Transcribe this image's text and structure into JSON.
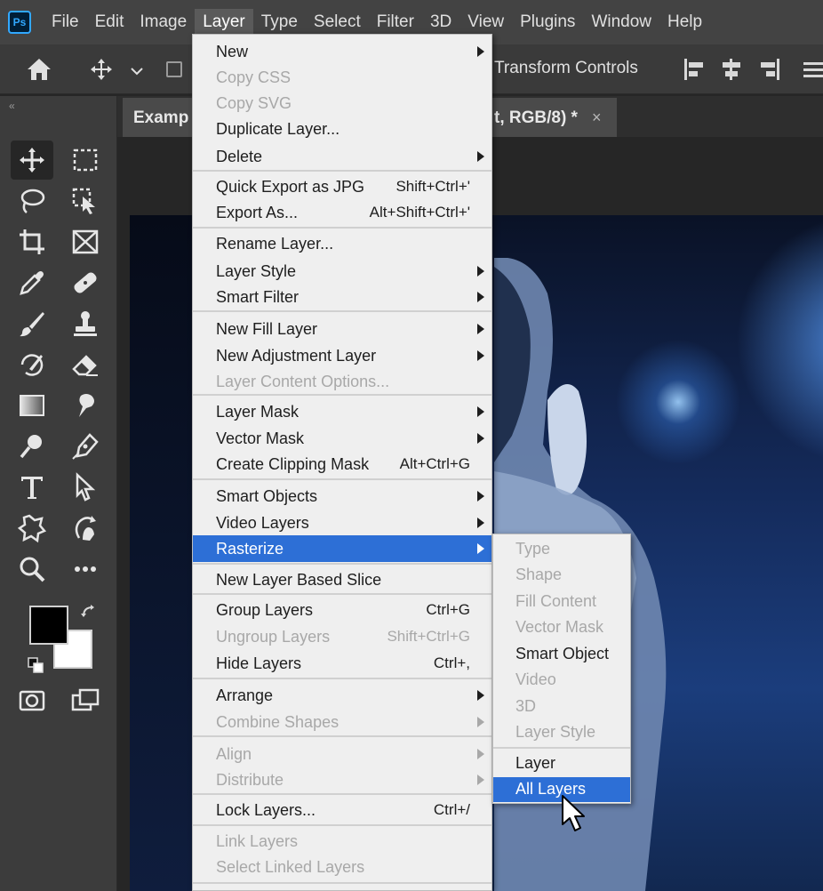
{
  "menubar": {
    "logo": "Ps",
    "items": [
      "File",
      "Edit",
      "Image",
      "Layer",
      "Type",
      "Select",
      "Filter",
      "3D",
      "View",
      "Plugins",
      "Window",
      "Help"
    ]
  },
  "options_bar": {
    "transform_label": "Transform Controls"
  },
  "document_tab": {
    "title_left": "Examp",
    "title_right": "t, RGB/8) *",
    "close": "×"
  },
  "toolbar": {
    "grip": "«"
  },
  "layer_menu": {
    "items": [
      {
        "label": "New",
        "submenu": true
      },
      {
        "label": "Copy CSS",
        "disabled": true
      },
      {
        "label": "Copy SVG",
        "disabled": true
      },
      {
        "label": "Duplicate Layer..."
      },
      {
        "label": "Delete",
        "submenu": true
      },
      {
        "label": "Quick Export as JPG",
        "shortcut": "Shift+Ctrl+'"
      },
      {
        "label": "Export As...",
        "shortcut": "Alt+Shift+Ctrl+'"
      },
      {
        "label": "Rename Layer..."
      },
      {
        "label": "Layer Style",
        "submenu": true
      },
      {
        "label": "Smart Filter",
        "submenu": true
      },
      {
        "label": "New Fill Layer",
        "submenu": true
      },
      {
        "label": "New Adjustment Layer",
        "submenu": true
      },
      {
        "label": "Layer Content Options...",
        "disabled": true
      },
      {
        "label": "Layer Mask",
        "submenu": true
      },
      {
        "label": "Vector Mask",
        "submenu": true
      },
      {
        "label": "Create Clipping Mask",
        "shortcut": "Alt+Ctrl+G"
      },
      {
        "label": "Smart Objects",
        "submenu": true
      },
      {
        "label": "Video Layers",
        "submenu": true
      },
      {
        "label": "Rasterize",
        "submenu": true,
        "highlighted": true
      },
      {
        "label": "New Layer Based Slice"
      },
      {
        "label": "Group Layers",
        "shortcut": "Ctrl+G"
      },
      {
        "label": "Ungroup Layers",
        "shortcut": "Shift+Ctrl+G",
        "disabled": true
      },
      {
        "label": "Hide Layers",
        "shortcut": "Ctrl+,"
      },
      {
        "label": "Arrange",
        "submenu": true
      },
      {
        "label": "Combine Shapes",
        "submenu": true,
        "disabled": true
      },
      {
        "label": "Align",
        "submenu": true,
        "disabled": true
      },
      {
        "label": "Distribute",
        "submenu": true,
        "disabled": true
      },
      {
        "label": "Lock Layers...",
        "shortcut": "Ctrl+/"
      },
      {
        "label": "Link Layers",
        "disabled": true
      },
      {
        "label": "Select Linked Layers",
        "disabled": true
      }
    ]
  },
  "rasterize_submenu": {
    "items": [
      {
        "label": "Type",
        "disabled": true
      },
      {
        "label": "Shape",
        "disabled": true
      },
      {
        "label": "Fill Content",
        "disabled": true
      },
      {
        "label": "Vector Mask",
        "disabled": true
      },
      {
        "label": "Smart Object"
      },
      {
        "label": "Video",
        "disabled": true
      },
      {
        "label": "3D",
        "disabled": true
      },
      {
        "label": "Layer Style",
        "disabled": true
      },
      {
        "label": "Layer"
      },
      {
        "label": "All Layers",
        "highlighted": true
      }
    ]
  },
  "colors": {
    "menu_highlight": "#2d6fd6",
    "menubar_bg": "#434343",
    "menu_bg": "#efefef",
    "disabled_text": "#a8a8a8"
  }
}
